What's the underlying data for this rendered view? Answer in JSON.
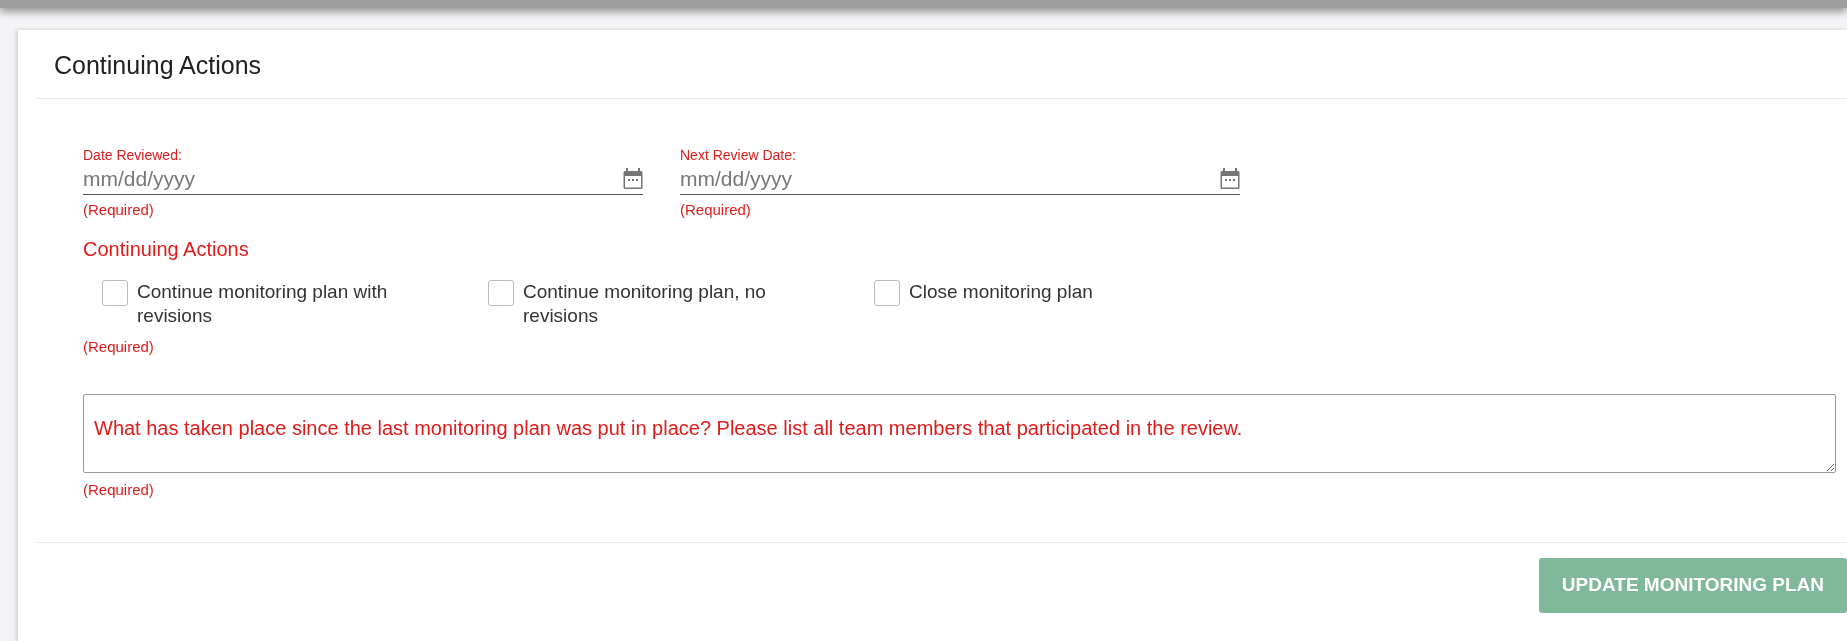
{
  "card": {
    "title": "Continuing Actions",
    "date_fields": [
      {
        "label": "Date Reviewed:",
        "placeholder": "mm/dd/yyyy",
        "hint": "(Required)"
      },
      {
        "label": "Next Review Date:",
        "placeholder": "mm/dd/yyyy",
        "hint": "(Required)"
      }
    ],
    "actions": {
      "heading": "Continuing Actions",
      "options": [
        {
          "label": "Continue monitoring plan with revisions",
          "checked": false
        },
        {
          "label": "Continue monitoring plan, no revisions",
          "checked": false
        },
        {
          "label": "Close monitoring plan",
          "checked": false
        }
      ],
      "hint": "(Required)"
    },
    "notes": {
      "placeholder": "What has taken place since the last monitoring plan was put in place? Please list all team members that participated in the review.",
      "hint": "(Required)"
    },
    "submit": {
      "label": "UPDATE MONITORING PLAN",
      "disabled": true
    }
  }
}
